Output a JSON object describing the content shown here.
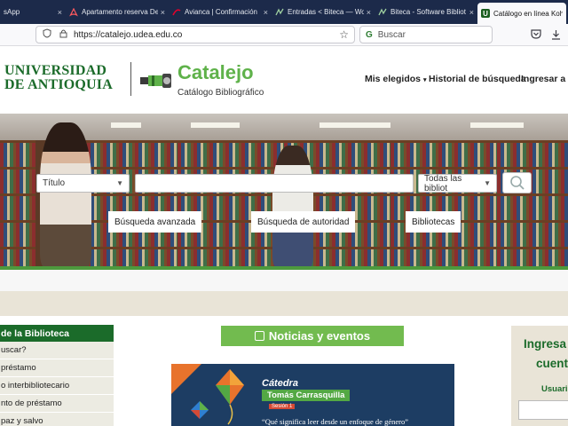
{
  "browser": {
    "tabs": [
      {
        "label": "sApp",
        "icon": "whatsapp-icon",
        "active": false
      },
      {
        "label": "Apartamento reserva Del",
        "icon": "airbnb-icon",
        "active": false
      },
      {
        "label": "Avianca | Confirmación",
        "icon": "avianca-icon",
        "active": false
      },
      {
        "label": "Entradas < Biteca — Wo",
        "icon": "wordpress-icon",
        "active": false
      },
      {
        "label": "Biteca - Software Bibliot",
        "icon": "biteca-icon",
        "active": false
      },
      {
        "label": "Catálogo en línea Koha",
        "icon": "udea-icon",
        "active": true
      }
    ],
    "url": "https://catalejo.udea.edu.co",
    "search_placeholder": "Buscar",
    "close_glyph": "×"
  },
  "header": {
    "university_line1": "UNIVERSIDAD",
    "university_line2": "DE ANTIOQUIA",
    "brand": "Catalejo",
    "brand_subtitle": "Catálogo Bibliográfico",
    "nav": {
      "favorites": "Mis elegidos",
      "history": "Historial de búsqueda",
      "login": "Ingresar a su"
    }
  },
  "search": {
    "index_selected": "Título",
    "query_value": "",
    "library_selected": "Todas las bibliot",
    "advanced": "Búsqueda avanzada",
    "authority": "Búsqueda de autoridad",
    "libraries": "Bibliotecas"
  },
  "sidebar": {
    "title": "de la Biblioteca",
    "items": [
      {
        "label": "uscar?"
      },
      {
        "label": "préstamo"
      },
      {
        "label": "o interbibliotecario"
      },
      {
        "label": "nto de préstamo"
      },
      {
        "label": "paz y salvo"
      }
    ]
  },
  "news": {
    "title": "Noticias y eventos",
    "banner": {
      "category": "Cátedra",
      "name": "Tomás Carrasquilla",
      "session": "Sesión 1",
      "question": "“Qué significa leer desde un enfoque de género”"
    }
  },
  "login_box": {
    "title_line1": "Ingresa",
    "title_line2": "cuent",
    "user_label": "Usuario"
  },
  "colors": {
    "udea_green": "#1b6b2a",
    "catalejo_green": "#5fb24a",
    "news_green": "#72bb4f",
    "tabstrip": "#1c2a4a"
  }
}
